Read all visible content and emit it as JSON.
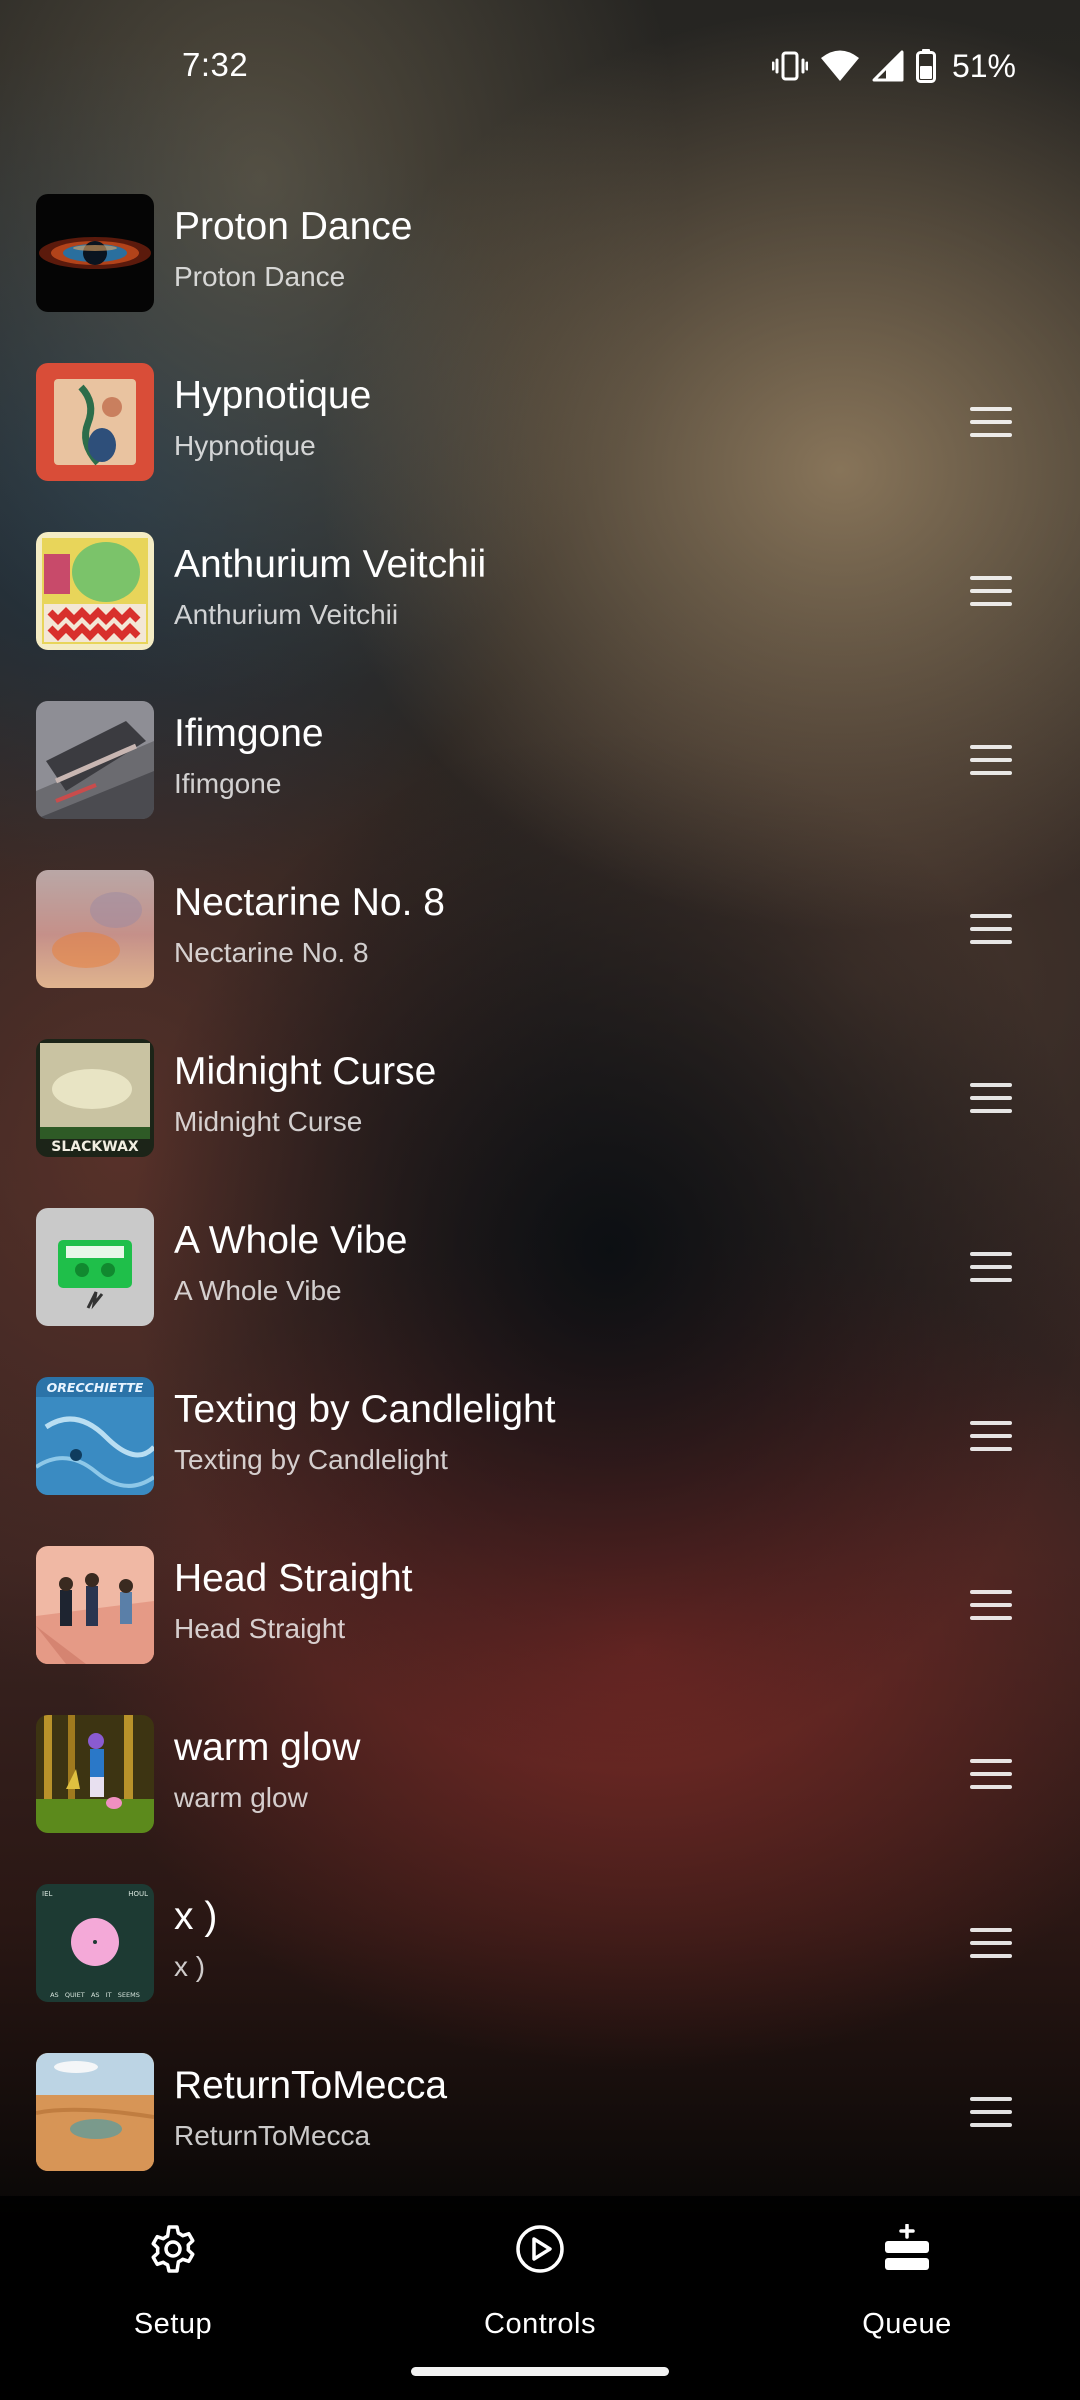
{
  "status_bar": {
    "time": "7:32",
    "battery": "51%",
    "icons": [
      "vibrate-icon",
      "wifi-icon",
      "cell-signal-icon",
      "battery-icon"
    ]
  },
  "queue": {
    "items": [
      {
        "title": "Proton Dance",
        "subtitle": "Proton Dance",
        "reorderable": false
      },
      {
        "title": "Hypnotique",
        "subtitle": "Hypnotique",
        "reorderable": true
      },
      {
        "title": "Anthurium Veitchii",
        "subtitle": "Anthurium Veitchii",
        "reorderable": true
      },
      {
        "title": "Ifimgone",
        "subtitle": "Ifimgone",
        "reorderable": true
      },
      {
        "title": "Nectarine No. 8",
        "subtitle": "Nectarine No. 8",
        "reorderable": true
      },
      {
        "title": "Midnight Curse",
        "subtitle": "Midnight Curse",
        "reorderable": true
      },
      {
        "title": "A Whole Vibe",
        "subtitle": "A Whole Vibe",
        "reorderable": true
      },
      {
        "title": "Texting by Candlelight",
        "subtitle": "Texting by Candlelight",
        "reorderable": true
      },
      {
        "title": "Head Straight",
        "subtitle": "Head Straight",
        "reorderable": true
      },
      {
        "title": "warm glow",
        "subtitle": "warm glow",
        "reorderable": true
      },
      {
        "title": "x )",
        "subtitle": "x )",
        "reorderable": true
      },
      {
        "title": "ReturnToMecca",
        "subtitle": "ReturnToMecca",
        "reorderable": true
      }
    ],
    "art_text": {
      "midnight_curse": "SLACKWAX",
      "texting_by_candlelight": "ORECCHIETTE",
      "x_top_left": "IEL",
      "x_top_right": "HOUL",
      "x_bottom": "AS   QUIET   AS   IT   SEEMS"
    }
  },
  "bottom_nav": {
    "items": [
      {
        "label": "Setup",
        "icon": "gear-icon"
      },
      {
        "label": "Controls",
        "icon": "play-circle-icon"
      },
      {
        "label": "Queue",
        "icon": "queue-icon",
        "active": true
      }
    ]
  }
}
